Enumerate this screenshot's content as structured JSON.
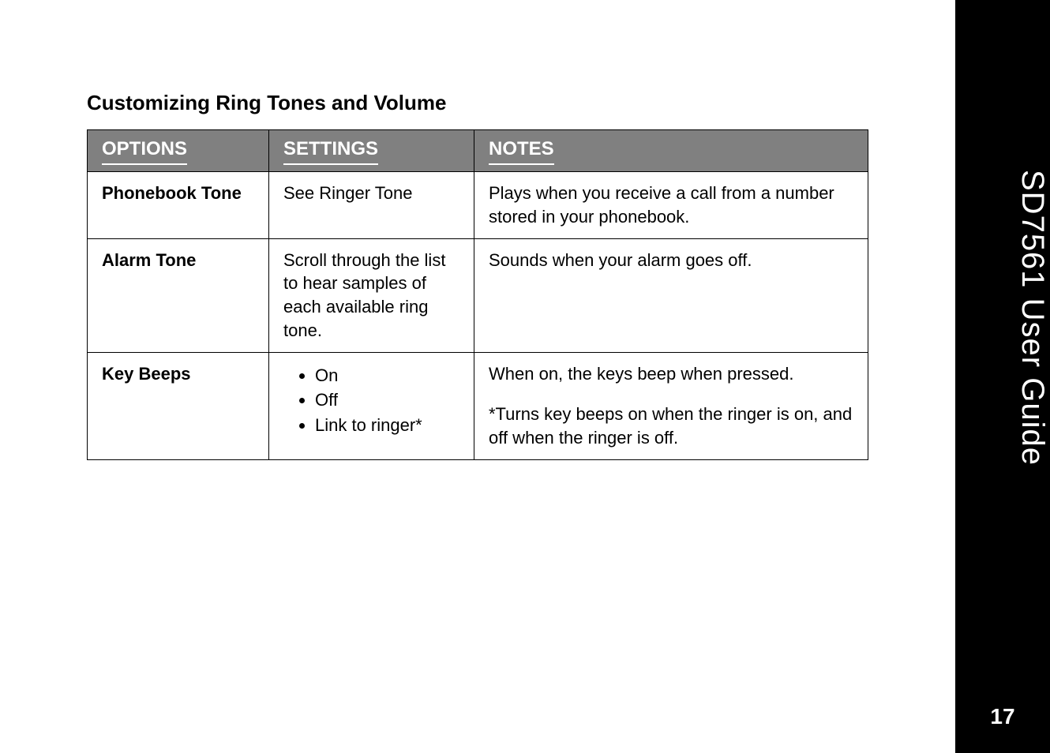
{
  "section_title": "Customizing Ring Tones and Volume",
  "headers": {
    "options": "OPTIONS",
    "settings": "SETTINGS",
    "notes": "NOTES"
  },
  "rows": [
    {
      "option": "Phonebook Tone",
      "setting_text": "See Ringer Tone",
      "setting_list": null,
      "notes": [
        "Plays when you receive a call from a number stored in your phonebook."
      ]
    },
    {
      "option": "Alarm Tone",
      "setting_text": "Scroll through the list to hear samples of each available ring tone.",
      "setting_list": null,
      "notes": [
        "Sounds when your alarm goes off."
      ]
    },
    {
      "option": "Key Beeps",
      "setting_text": null,
      "setting_list": [
        "On",
        "Off",
        "Link to ringer*"
      ],
      "notes": [
        "When on, the keys beep when pressed.",
        "*Turns key beeps on when the ringer is on, and off when the ringer is off."
      ]
    }
  ],
  "side_tab": "SD7561 User Guide",
  "page_number": "17"
}
